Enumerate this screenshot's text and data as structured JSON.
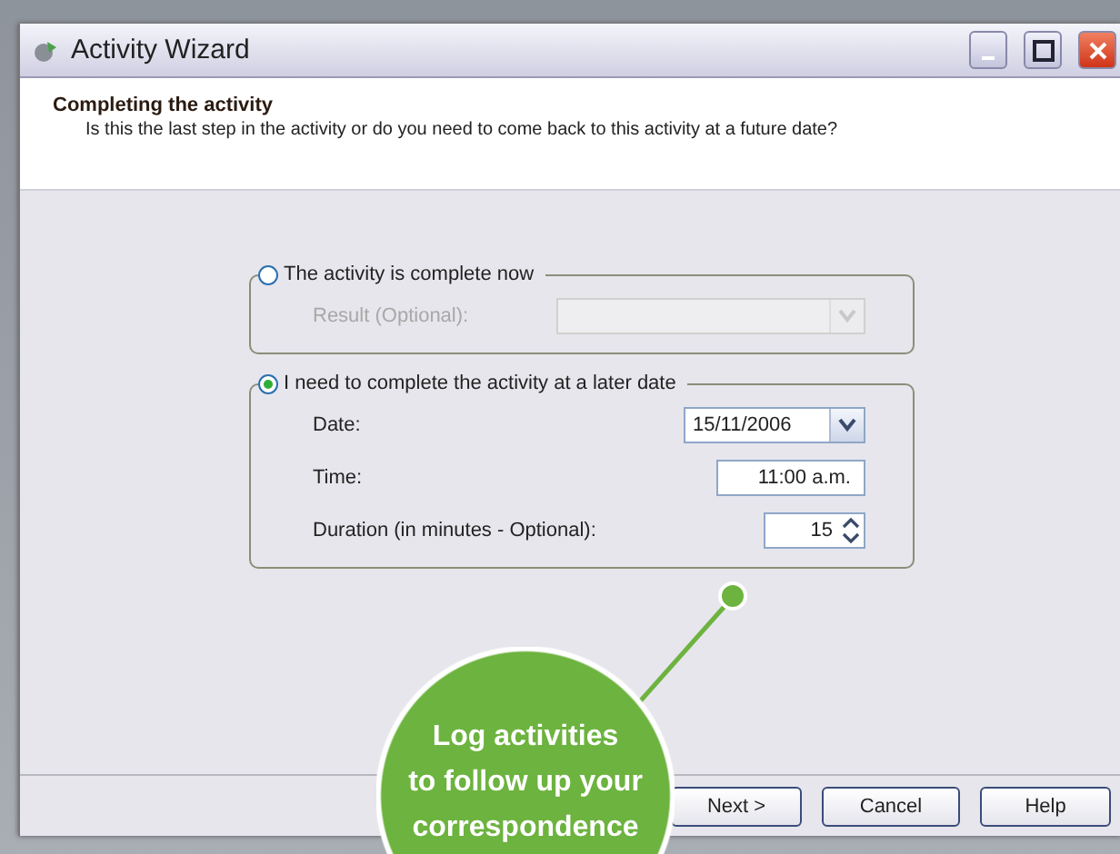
{
  "window": {
    "title": "Activity Wizard"
  },
  "header": {
    "title": "Completing the activity",
    "subtitle": "Is this the last step in the activity or do you need to come back to this activity at a future date?"
  },
  "options": [
    {
      "label": "The activity is complete now",
      "selected": false,
      "fields": [
        {
          "kind": "dropdown",
          "label": "Result (Optional):",
          "disabled": true
        }
      ]
    },
    {
      "label": "I need to complete the activity at a later date",
      "selected": true,
      "fields": [
        {
          "kind": "dropdown",
          "label": "Date:",
          "value": "15/11/2006",
          "disabled": false
        },
        {
          "kind": "text",
          "label": "Time:",
          "value": "11:00 a.m.",
          "disabled": false
        },
        {
          "kind": "spinner",
          "label": "Duration (in minutes - Optional):",
          "value": "15",
          "disabled": false
        }
      ]
    }
  ],
  "buttons": [
    "Next >",
    "Cancel",
    "Help"
  ],
  "callout": {
    "lines": [
      "Log activities",
      "to follow up your",
      "correspondence"
    ]
  }
}
